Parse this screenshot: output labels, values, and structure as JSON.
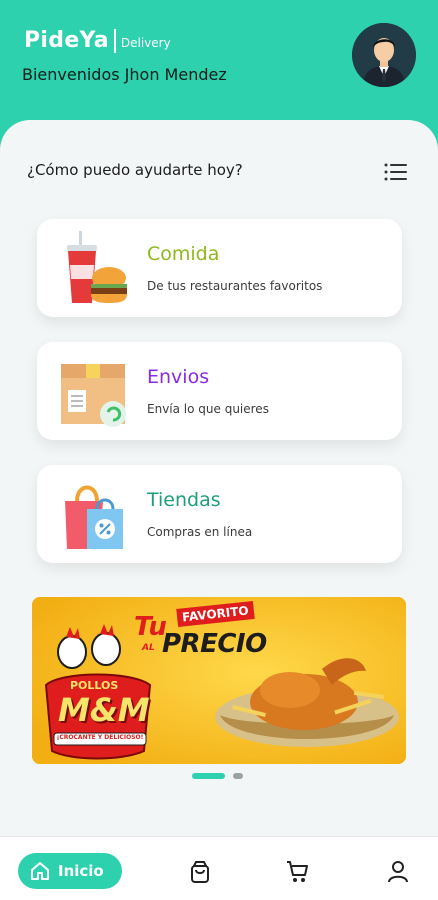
{
  "header": {
    "brand": "PideYa",
    "brand_sub": "Delivery",
    "welcome": "Bienvenidos Jhon Mendez"
  },
  "main": {
    "question": "¿Cómo puedo ayudarte hoy?",
    "services": [
      {
        "title": "Comida",
        "description": "De tus restaurantes favoritos",
        "color": "#8fb81e"
      },
      {
        "title": "Envios",
        "description": "Envía lo que quieres",
        "color": "#8a2be2"
      },
      {
        "title": "Tiendas",
        "description": "Compras en línea",
        "color": "#1e9e7c"
      }
    ]
  },
  "banner": {
    "headline_tu": "Tu",
    "headline_favorito": "FAVORITO",
    "headline_al": "AL",
    "headline_precio": "PRECIO",
    "brand_top": "POLLOS",
    "brand_main": "M&M",
    "brand_tagline": "¡CROCANTE Y DELICIOSO!"
  },
  "carousel": {
    "current": 1,
    "total": 2
  },
  "bottom_nav": {
    "home_label": "Inicio"
  },
  "colors": {
    "accent": "#2dd1ad",
    "background": "#f3f6f6"
  }
}
